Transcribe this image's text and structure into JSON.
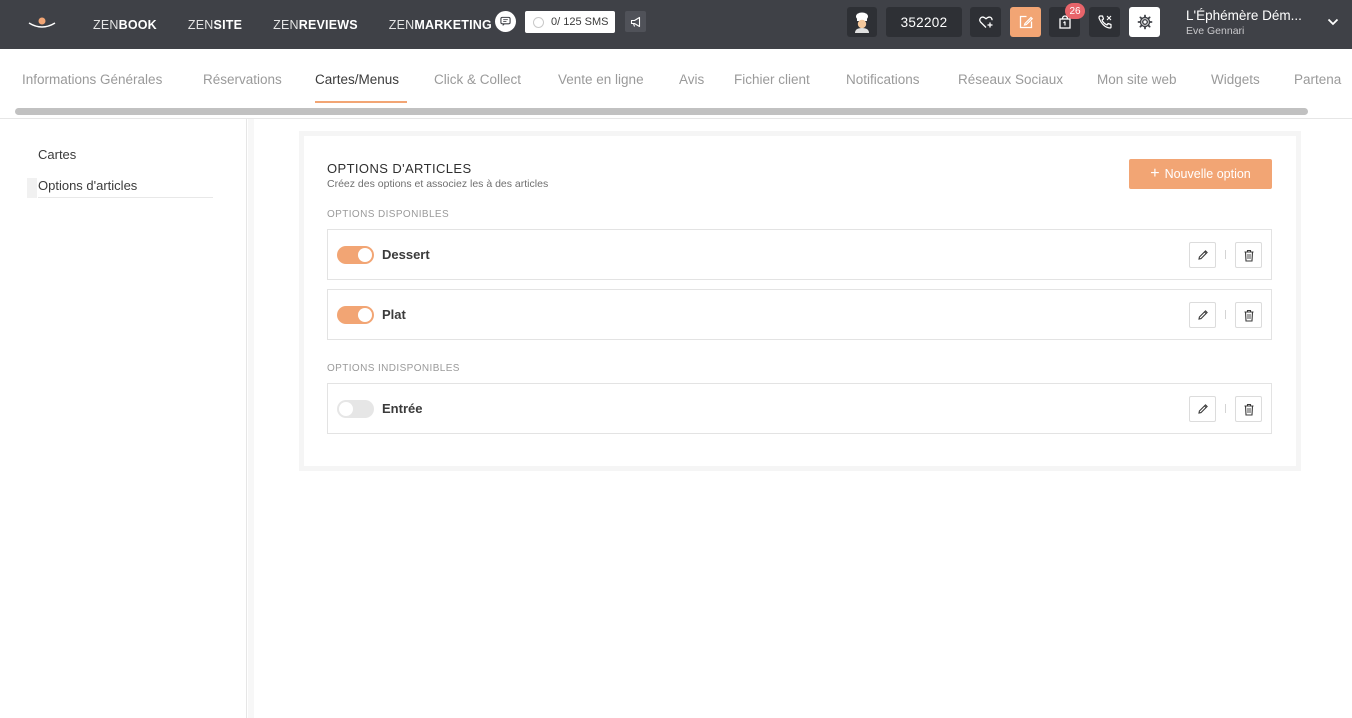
{
  "topbar": {
    "zen_nav": [
      {
        "prefix": "ZEN",
        "suffix": "BOOK"
      },
      {
        "prefix": "ZEN",
        "suffix": "SITE"
      },
      {
        "prefix": "ZEN",
        "suffix": "REVIEWS"
      },
      {
        "prefix": "ZEN",
        "suffix": "MARKETING"
      }
    ],
    "sms_counter": "0/ 125 SMS",
    "account_id": "352202",
    "notification_count": "26",
    "restaurant_name": "L'Éphémère Dém...",
    "user_name": "Eve Gennari",
    "colors": {
      "bar": "#3f4147",
      "accent": "#f2a574",
      "badge": "#e8646a"
    }
  },
  "tabs": [
    "Informations Générales",
    "Réservations",
    "Cartes/Menus",
    "Click & Collect",
    "Vente en ligne",
    "Avis",
    "Fichier client",
    "Notifications",
    "Réseaux Sociaux",
    "Mon site web",
    "Widgets",
    "Partena"
  ],
  "active_tab": "Cartes/Menus",
  "sidebar": {
    "items": [
      "Cartes",
      "Options d'articles"
    ],
    "active": "Options d'articles"
  },
  "card": {
    "title": "OPTIONS D'ARTICLES",
    "subtitle": "Créez des options et associez les à des articles",
    "new_button": "Nouvelle option",
    "available_label": "OPTIONS DISPONIBLES",
    "unavailable_label": "OPTIONS INDISPONIBLES",
    "available": [
      {
        "name": "Dessert",
        "enabled": true
      },
      {
        "name": "Plat",
        "enabled": true
      }
    ],
    "unavailable": [
      {
        "name": "Entrée",
        "enabled": false
      }
    ]
  }
}
